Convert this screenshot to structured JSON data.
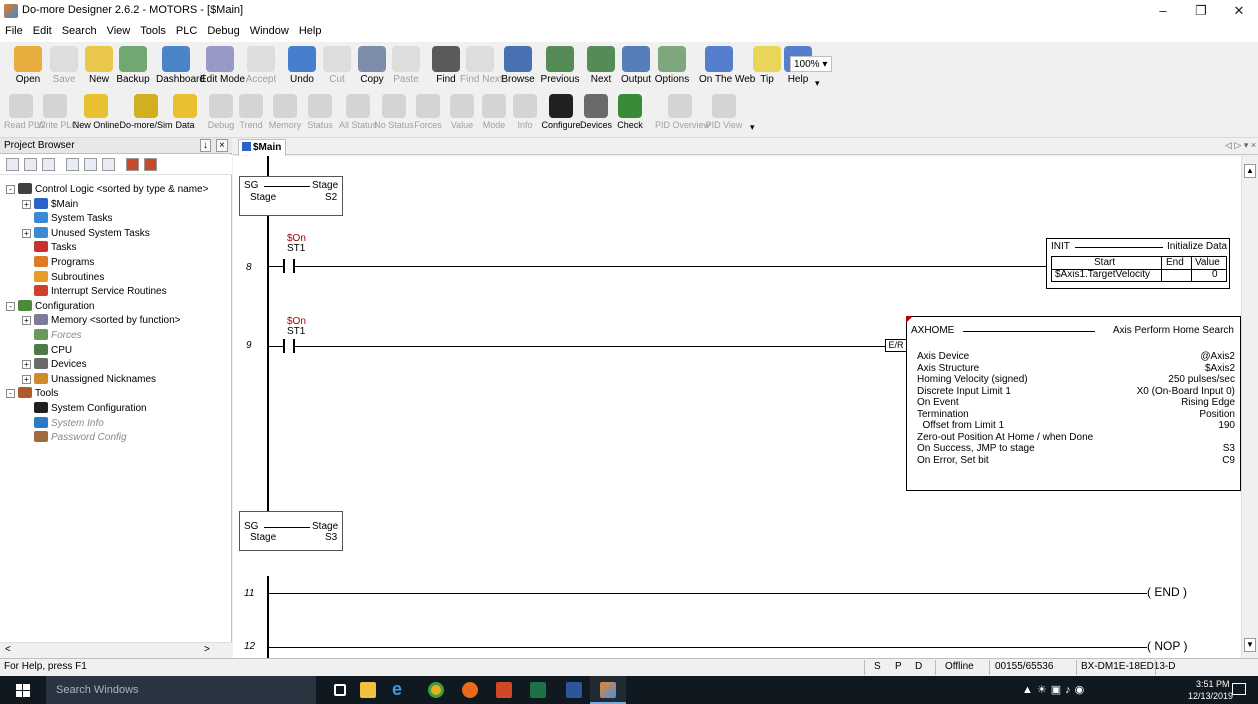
{
  "window": {
    "title": "Do-more Designer 2.6.2 - MOTORS - [$Main]"
  },
  "menu": [
    "File",
    "Edit",
    "Search",
    "View",
    "Tools",
    "PLC",
    "Debug",
    "Window",
    "Help"
  ],
  "toolbar1": [
    {
      "label": "Open",
      "enabled": true
    },
    {
      "label": "Save",
      "enabled": false
    },
    {
      "label": "New",
      "enabled": true
    },
    {
      "label": "Backup",
      "enabled": true
    },
    {
      "label": "Dashboard",
      "enabled": true
    },
    {
      "label": "Edit Mode",
      "enabled": true
    },
    {
      "label": "Accept",
      "enabled": false
    },
    {
      "label": "Undo",
      "enabled": true
    },
    {
      "label": "Cut",
      "enabled": false
    },
    {
      "label": "Copy",
      "enabled": true
    },
    {
      "label": "Paste",
      "enabled": false
    },
    {
      "label": "Find",
      "enabled": true
    },
    {
      "label": "Find Next",
      "enabled": false
    },
    {
      "label": "Browse",
      "enabled": true
    },
    {
      "label": "Previous",
      "enabled": true
    },
    {
      "label": "Next",
      "enabled": true
    },
    {
      "label": "Output",
      "enabled": true
    },
    {
      "label": "Options",
      "enabled": true
    },
    {
      "label": "On The Web",
      "enabled": true
    },
    {
      "label": "Tip",
      "enabled": true
    },
    {
      "label": "Help",
      "enabled": true
    }
  ],
  "zoom": "100%",
  "toolbar2": [
    {
      "label": "Read PLC",
      "enabled": false
    },
    {
      "label": "Write PLC",
      "enabled": false
    },
    {
      "label": "New Online",
      "enabled": true
    },
    {
      "label": "Do-more/Sim",
      "enabled": true
    },
    {
      "label": "Data",
      "enabled": true
    },
    {
      "label": "Debug",
      "enabled": false
    },
    {
      "label": "Trend",
      "enabled": false
    },
    {
      "label": "Memory",
      "enabled": false
    },
    {
      "label": "Status",
      "enabled": false
    },
    {
      "label": "All Status",
      "enabled": false
    },
    {
      "label": "No Status",
      "enabled": false
    },
    {
      "label": "Forces",
      "enabled": false
    },
    {
      "label": "Value",
      "enabled": false
    },
    {
      "label": "Mode",
      "enabled": false
    },
    {
      "label": "Info",
      "enabled": false
    },
    {
      "label": "Configure",
      "enabled": true
    },
    {
      "label": "Devices",
      "enabled": true
    },
    {
      "label": "Check",
      "enabled": true
    },
    {
      "label": "PID Overview",
      "enabled": false
    },
    {
      "label": "PID View",
      "enabled": false
    }
  ],
  "project_browser": {
    "title": "Project Browser",
    "items": [
      {
        "label": "Control Logic <sorted by type & name>",
        "indent": 0,
        "exp": "-",
        "color": "#404040",
        "gray": false
      },
      {
        "label": "$Main",
        "indent": 1,
        "exp": "+",
        "color": "#2a63c7",
        "gray": false
      },
      {
        "label": "System Tasks",
        "indent": 1,
        "exp": "",
        "color": "#3a8ad6",
        "gray": false
      },
      {
        "label": "Unused System Tasks",
        "indent": 1,
        "exp": "+",
        "color": "#3a8ad6",
        "gray": false
      },
      {
        "label": "Tasks",
        "indent": 1,
        "exp": "",
        "color": "#c8342b",
        "gray": false
      },
      {
        "label": "Programs",
        "indent": 1,
        "exp": "",
        "color": "#e07a22",
        "gray": false
      },
      {
        "label": "Subroutines",
        "indent": 1,
        "exp": "",
        "color": "#e89a2a",
        "gray": false
      },
      {
        "label": "Interrupt Service Routines",
        "indent": 1,
        "exp": "",
        "color": "#d0402a",
        "gray": false
      },
      {
        "label": "Configuration",
        "indent": 0,
        "exp": "-",
        "color": "#4a8a3a",
        "gray": false
      },
      {
        "label": "Memory <sorted by function>",
        "indent": 1,
        "exp": "+",
        "color": "#7a7a9a",
        "gray": false
      },
      {
        "label": "Forces",
        "indent": 1,
        "exp": "",
        "color": "#6a9a5a",
        "gray": true
      },
      {
        "label": "CPU",
        "indent": 1,
        "exp": "",
        "color": "#4a7a4a",
        "gray": false
      },
      {
        "label": "Devices",
        "indent": 1,
        "exp": "+",
        "color": "#6a6a6a",
        "gray": false
      },
      {
        "label": "Unassigned Nicknames",
        "indent": 1,
        "exp": "+",
        "color": "#d08a2a",
        "gray": false
      },
      {
        "label": "Tools",
        "indent": 0,
        "exp": "-",
        "color": "#b05a2a",
        "gray": false
      },
      {
        "label": "System Configuration",
        "indent": 1,
        "exp": "",
        "color": "#202020",
        "gray": false
      },
      {
        "label": "System Info",
        "indent": 1,
        "exp": "",
        "color": "#2a7ac8",
        "gray": true
      },
      {
        "label": "Password Config",
        "indent": 1,
        "exp": "",
        "color": "#a06a3a",
        "gray": true
      }
    ]
  },
  "tab": {
    "label": "$Main"
  },
  "ladder": {
    "stage1": {
      "top": "SG",
      "right": "Stage",
      "bottom_left": "Stage",
      "bottom_right": "S2"
    },
    "rung8": {
      "num": "8",
      "contact_nick": "$On",
      "contact_addr": "ST1",
      "box": {
        "name": "INIT",
        "desc": "Initialize Data",
        "h_start": "Start",
        "h_end": "End",
        "h_value": "Value",
        "r_start": "$Axis1.TargetVelocity",
        "r_end": "",
        "r_value": "0"
      }
    },
    "rung9": {
      "num": "9",
      "contact_nick": "$On",
      "contact_addr": "ST1",
      "er": "E/R",
      "box": {
        "name": "AXHOME",
        "desc": "Axis Perform Home Search",
        "params": [
          {
            "k": "Axis Device",
            "v": "@Axis2"
          },
          {
            "k": "Axis Structure",
            "v": "$Axis2"
          },
          {
            "k": "Homing Velocity (signed)",
            "v": "250 pulses/sec"
          },
          {
            "k": "Discrete Input Limit 1",
            "v": "X0 (On-Board Input 0)"
          },
          {
            "k": "On Event",
            "v": "Rising Edge"
          },
          {
            "k": "Termination",
            "v": "Position"
          },
          {
            "k": "  Offset from Limit 1",
            "v": "190"
          },
          {
            "k": "Zero-out Position At Home / when Done",
            "v": ""
          },
          {
            "k": "On Success, JMP to stage",
            "v": "S3"
          },
          {
            "k": "On Error, Set bit",
            "v": "C9"
          }
        ]
      }
    },
    "stage2": {
      "top": "SG",
      "right": "Stage",
      "bottom_left": "Stage",
      "bottom_right": "S3"
    },
    "rung11": {
      "num": "11",
      "coil": "( END )"
    },
    "rung12": {
      "num": "12",
      "coil": "( NOP )"
    }
  },
  "status": {
    "help": "For Help, press F1",
    "s": "S",
    "p": "P",
    "d": "D",
    "mode": "Offline",
    "mem": "00155/65536",
    "device": "BX-DM1E-18ED13-D"
  },
  "taskbar": {
    "search": "Search Windows",
    "time": "3:51 PM",
    "date": "12/13/2019"
  }
}
